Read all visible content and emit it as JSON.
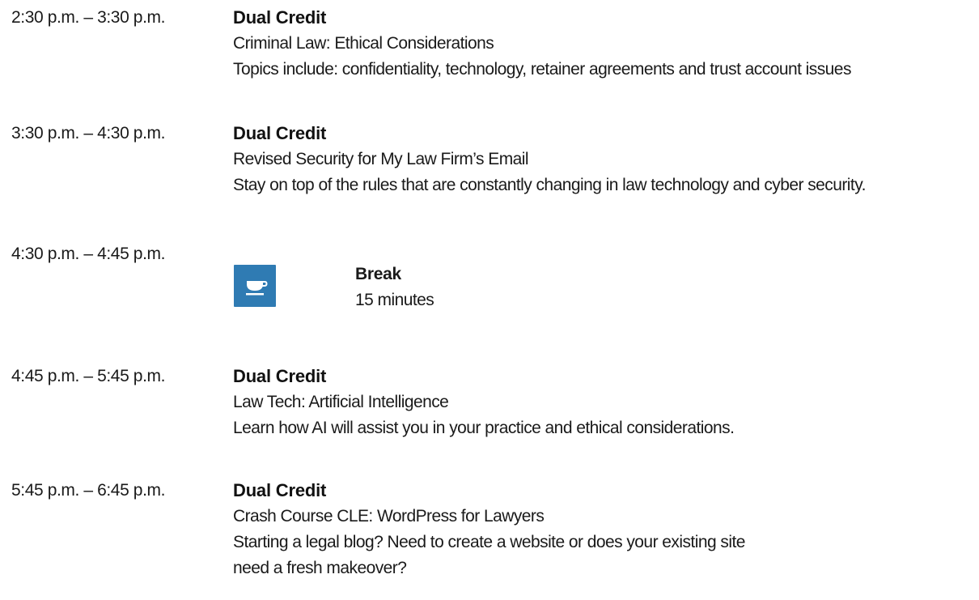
{
  "sessions": [
    {
      "time": "2:30 p.m. – 3:30 p.m.",
      "credit": "Dual Credit",
      "title": "Criminal Law: Ethical Considerations",
      "description": "Topics include: confidentiality, technology, retainer agreements and trust account issues"
    },
    {
      "time": "3:30 p.m. – 4:30 p.m.",
      "credit": "Dual Credit",
      "title": "Revised Security for My Law Firm’s Email",
      "description": "Stay on top of the rules that are constantly changing in law technology and cyber security."
    },
    {
      "time": "4:45 p.m. – 5:45 p.m.",
      "credit": "Dual Credit",
      "title": "Law Tech: Artificial Intelligence",
      "description": "Learn how AI will assist you in your practice and ethical considerations."
    },
    {
      "time": "5:45 p.m. – 6:45 p.m.",
      "credit": "Dual Credit",
      "title": "Crash Course CLE: WordPress for Lawyers",
      "description": "Starting a legal blog? Need to create a website or does your existing site need a fresh makeover?"
    }
  ],
  "break": {
    "time": "4:30 p.m. – 4:45 p.m.",
    "title": "Break",
    "duration": "15 minutes",
    "icon": "coffee-cup-icon",
    "icon_color": "#2f7bb3"
  }
}
